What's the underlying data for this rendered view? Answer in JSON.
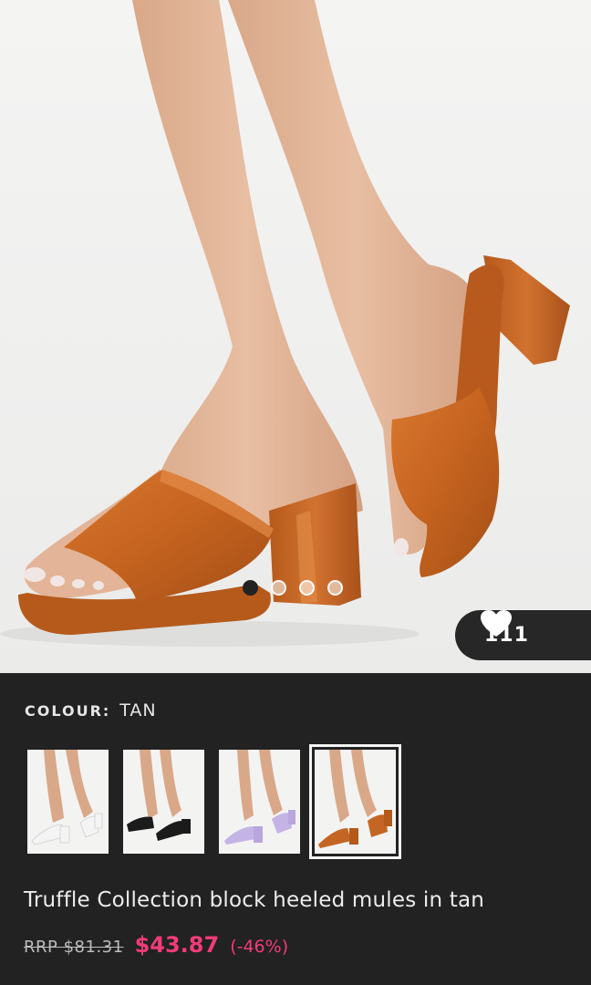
{
  "product": {
    "image_alt": "Tan block heeled mules worn on feet",
    "carousel": {
      "total": 4,
      "active_index": 0
    },
    "likes": {
      "count": "111",
      "icon": "heart-icon"
    },
    "colour": {
      "label": "COLOUR:",
      "value": "TAN"
    },
    "variants": [
      {
        "name": "white",
        "color": "#f4f4f4"
      },
      {
        "name": "black",
        "color": "#1b1b1b"
      },
      {
        "name": "lilac",
        "color": "#c4b4e6"
      },
      {
        "name": "tan",
        "color": "#c46524",
        "selected": true
      }
    ],
    "title": "Truffle Collection block heeled mules in tan",
    "price": {
      "rrp": "RRP $81.31",
      "sale": "$43.87",
      "discount": "(-46%)"
    }
  },
  "colors": {
    "background": "#222222",
    "sale": "#f23b7a",
    "shoe": "#c46524"
  }
}
